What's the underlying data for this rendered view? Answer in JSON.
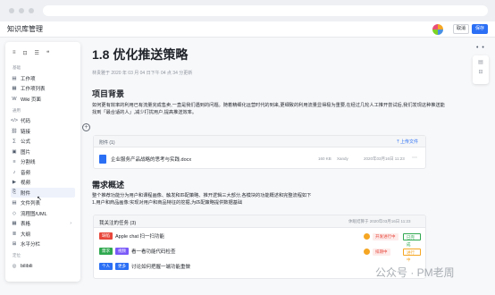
{
  "header": {
    "app_title": "知识库管理",
    "cancel_label": "取消",
    "save_label": "保存"
  },
  "block_menu": {
    "top_icons": [
      "≡",
      "⊡",
      "☰",
      "❝"
    ],
    "groups": [
      {
        "label": "基础",
        "items": [
          {
            "icon": "▤",
            "label": "工作项",
            "name": "work-item"
          },
          {
            "icon": "▦",
            "label": "工作项列表",
            "name": "work-item-list"
          },
          {
            "icon": "W",
            "label": "Wiki 页面",
            "name": "wiki-page"
          }
        ]
      },
      {
        "label": "通用",
        "items": [
          {
            "icon": "</>",
            "label": "代码",
            "name": "code"
          },
          {
            "icon": "⛓",
            "label": "链接",
            "name": "link"
          },
          {
            "icon": "∑",
            "label": "公式",
            "name": "formula"
          },
          {
            "icon": "▣",
            "label": "图片",
            "name": "image"
          },
          {
            "icon": "≡",
            "label": "分割线",
            "name": "divider"
          },
          {
            "icon": "♪",
            "label": "音频",
            "name": "audio"
          },
          {
            "icon": "▶",
            "label": "视频",
            "name": "video"
          },
          {
            "icon": "⎘",
            "label": "附件",
            "name": "attachment",
            "hover": true
          },
          {
            "icon": "▤",
            "label": "文件列表",
            "name": "file-list"
          },
          {
            "icon": "◇",
            "label": "流程图/UML",
            "name": "flowchart"
          },
          {
            "icon": "▦",
            "label": "表格",
            "name": "table",
            "arrow": "›"
          },
          {
            "icon": "≣",
            "label": "大纲",
            "name": "outline"
          },
          {
            "icon": "⊞",
            "label": "水平分栏",
            "name": "columns"
          }
        ]
      },
      {
        "label": "定位",
        "items": [
          {
            "icon": "◎",
            "label": "bilibili",
            "name": "bilibili"
          }
        ]
      }
    ]
  },
  "doc": {
    "title": "1.8 优化推送策略",
    "meta": "林贵雅于 2020 年 03 月 04 日下午 04 点 34 分更新",
    "section1_heading": "项目背景",
    "section1_text": "如何更有效率的利用已有流量完成售卖,一直是我们遇到的问题。随着精细化运营时代的到来,更细致的利用流量显得极为重要,在经过几轮人工推开尝试后,我们发现这种推送能找到「最合适的人」,减少打扰用户,提高推送效率。",
    "section2_heading": "需求概述",
    "section2_line1": "整个推荐功能分为用户和课程画像、触发和匹配策略、推开逻辑三大部分,各模块的功能概述和完整流程如下",
    "section2_line2": "1.用户和商品画像:实现对用户和商品特征的挖掘,为匹配策略提供数据基础"
  },
  "attachments": {
    "title": "附件 (1)",
    "upload_label": "上传文件",
    "files": [
      {
        "name": "企业服务产品战略的思考与实践.docx",
        "size": "160 KB",
        "user": "Xandy",
        "date": "2020年03月16日 11:23"
      }
    ]
  },
  "tasks": {
    "title": "我关注的任务 (3)",
    "sync_text": "休眠结算于 2020年03月16日 11:23",
    "items": [
      {
        "tag": "缺陷",
        "tag_color": "#e8473b",
        "text": "Apple chat 扫一扫功能",
        "status": "开发进行中",
        "status_color": "#e8473b",
        "status_bg": "#fdeceb",
        "state": "已完成",
        "state_color": "#2fa84f"
      },
      {
        "tag": "需求",
        "tag_color": "#2fa84f",
        "tag2": "视频",
        "tag2_color": "#7a5af8",
        "text": "看一看功能代码检查",
        "status": "排期中",
        "status_color": "#e8473b",
        "status_bg": "#fdeceb",
        "state": "进行中",
        "state_color": "#f5a623"
      },
      {
        "tag": "个人",
        "tag_color": "#2b6ff5",
        "tag2": "更多",
        "tag2_color": "#2b6ff5",
        "text": "讨论如何把握一端功能重做",
        "status": "",
        "status_color": "",
        "status_bg": "",
        "state": "",
        "state_color": ""
      }
    ]
  },
  "right_tools": {
    "more_label": "• •",
    "tool1": "▤",
    "tool2": "⊟"
  },
  "watermark": "公众号 · PM老周"
}
